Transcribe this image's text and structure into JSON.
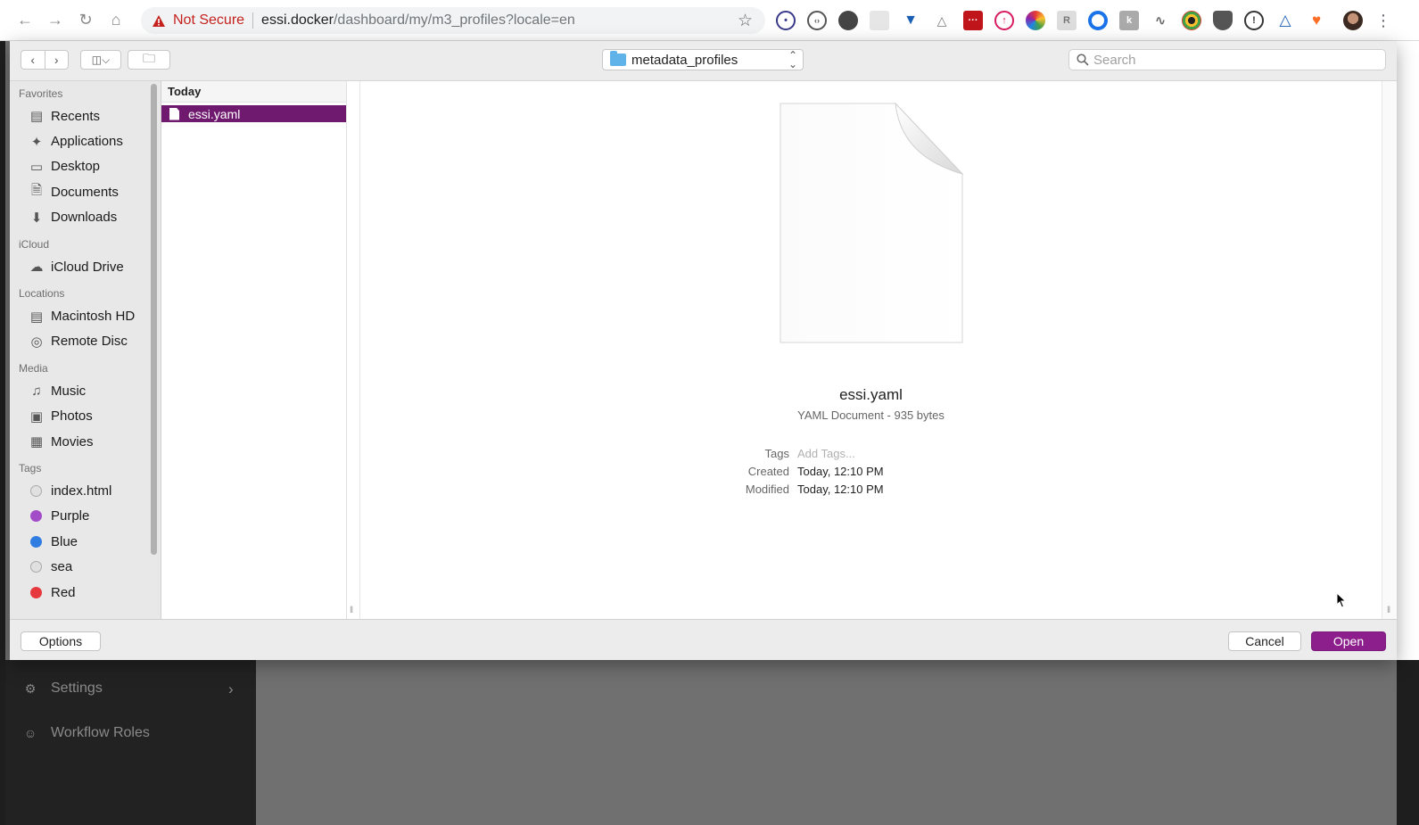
{
  "browser": {
    "security_label": "Not Secure",
    "url_host": "essi.docker",
    "url_path": "/dashboard/my/m3_profiles?locale=en"
  },
  "dialog": {
    "location": "metadata_profiles",
    "search_placeholder": "Search",
    "sidebar": {
      "sections": [
        {
          "title": "Favorites",
          "items": [
            {
              "label": "Recents",
              "icon": "recents-icon"
            },
            {
              "label": "Applications",
              "icon": "applications-icon"
            },
            {
              "label": "Desktop",
              "icon": "desktop-icon"
            },
            {
              "label": "Documents",
              "icon": "documents-icon"
            },
            {
              "label": "Downloads",
              "icon": "downloads-icon"
            }
          ]
        },
        {
          "title": "iCloud",
          "items": [
            {
              "label": "iCloud Drive",
              "icon": "cloud-icon"
            }
          ]
        },
        {
          "title": "Locations",
          "items": [
            {
              "label": "Macintosh HD",
              "icon": "hard-drive-icon"
            },
            {
              "label": "Remote Disc",
              "icon": "disc-icon"
            }
          ]
        },
        {
          "title": "Media",
          "items": [
            {
              "label": "Music",
              "icon": "music-icon"
            },
            {
              "label": "Photos",
              "icon": "camera-icon"
            },
            {
              "label": "Movies",
              "icon": "film-icon"
            }
          ]
        },
        {
          "title": "Tags",
          "items": [
            {
              "label": "index.html",
              "tag_color": "#d0d0d0"
            },
            {
              "label": "Purple",
              "tag_color": "#a24cc8"
            },
            {
              "label": "Blue",
              "tag_color": "#2f7de1"
            },
            {
              "label": "sea",
              "tag_color": "#d0d0d0"
            },
            {
              "label": "Red",
              "tag_color": "#e5393e"
            }
          ]
        }
      ]
    },
    "column": {
      "header": "Today",
      "selected_file": "essi.yaml"
    },
    "preview": {
      "name": "essi.yaml",
      "kind": "YAML Document - 935 bytes",
      "tags_label": "Tags",
      "tags_value": "Add Tags...",
      "created_label": "Created",
      "created_value": "Today, 12:10 PM",
      "modified_label": "Modified",
      "modified_value": "Today, 12:10 PM"
    },
    "buttons": {
      "options": "Options",
      "cancel": "Cancel",
      "open": "Open"
    }
  },
  "app_menu": {
    "items": [
      {
        "label": "Settings",
        "icon": "gear-icon"
      },
      {
        "label": "Workflow Roles",
        "icon": "users-icon"
      }
    ]
  },
  "colors": {
    "selection": "#6f1a6f",
    "primary_button": "#8c1f8c"
  }
}
